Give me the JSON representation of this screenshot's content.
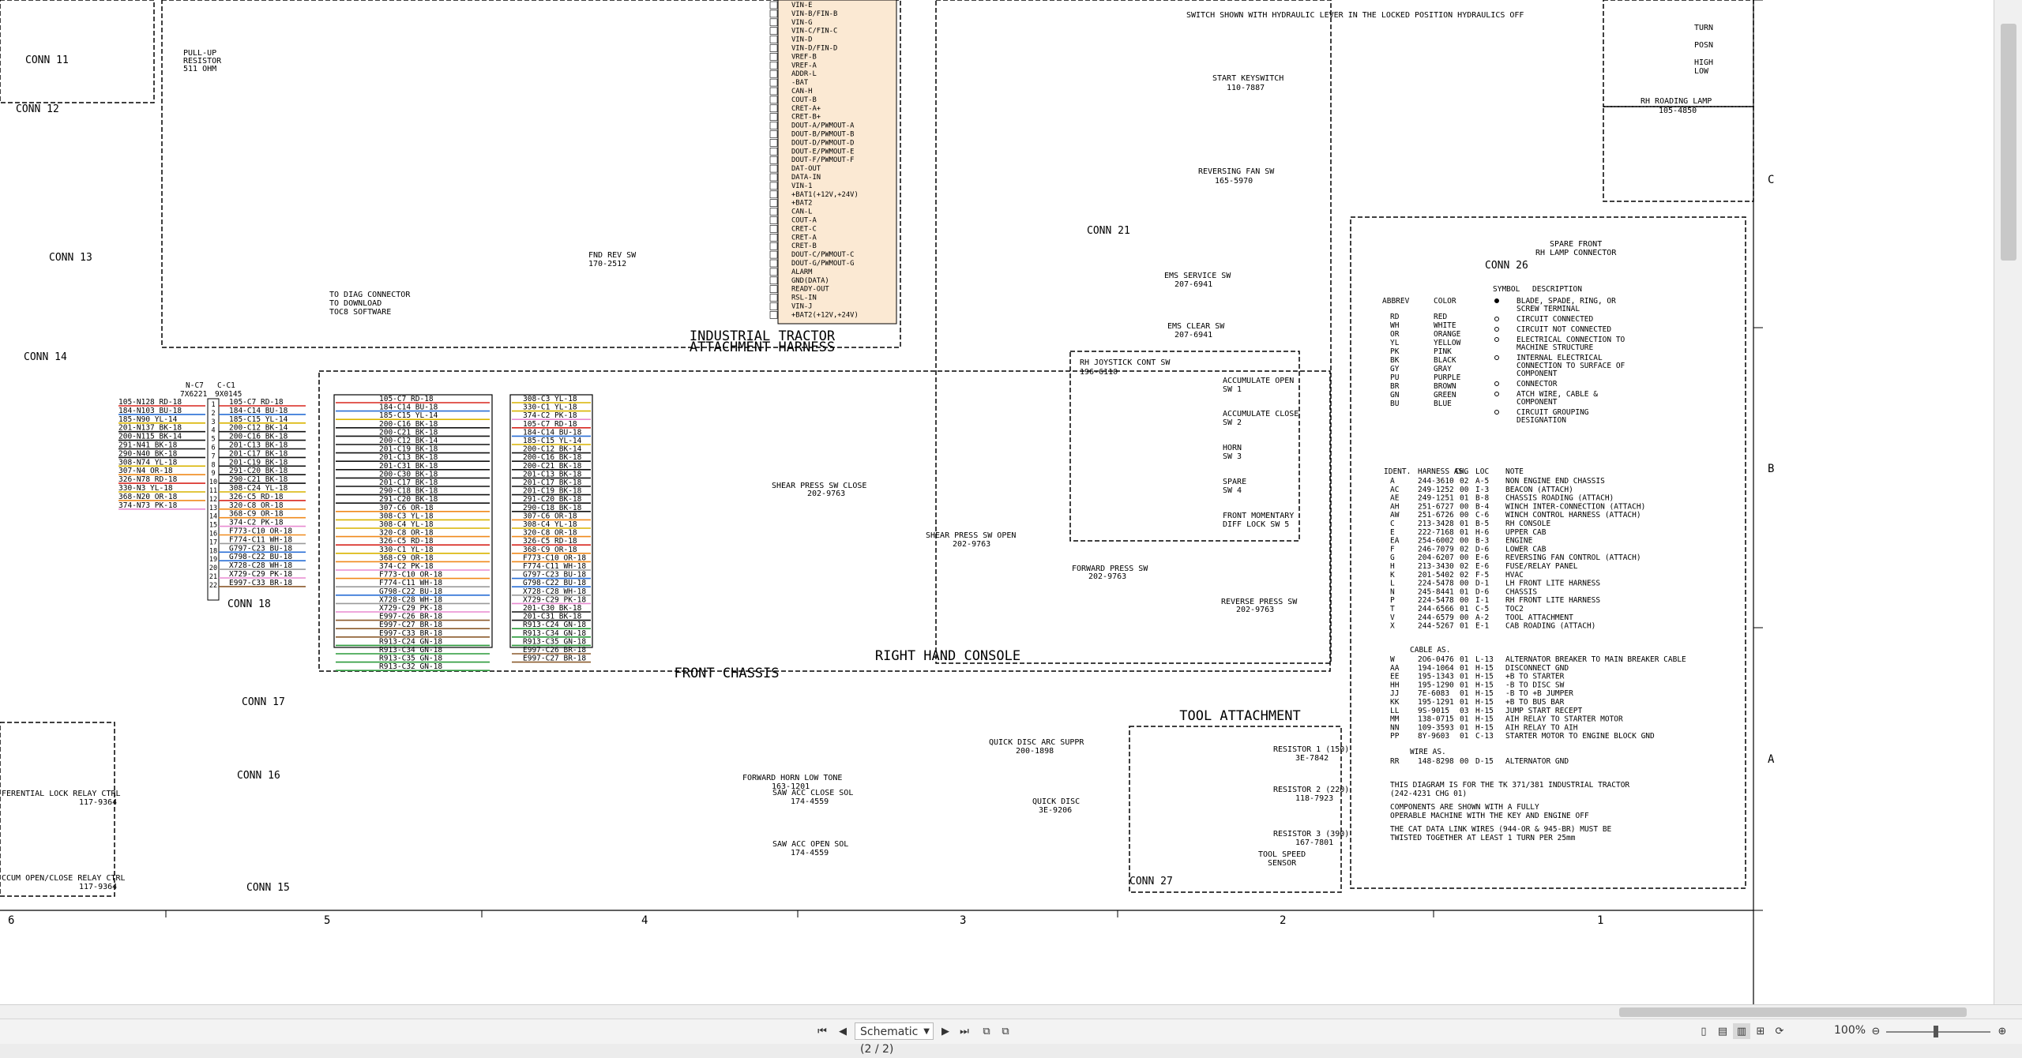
{
  "toolbar": {
    "page_selector": "Schematic (2 / 2)",
    "zoom": "100%"
  },
  "ruler": {
    "bottom": [
      "6",
      "5",
      "4",
      "3",
      "2",
      "1"
    ],
    "right": [
      "C",
      "B",
      "A"
    ]
  },
  "sections": {
    "industrial_tractor": "INDUSTRIAL TRACTOR",
    "attachment_harness": "ATTACHMENT HARNESS",
    "front_chassis": "FRONT CHASSIS",
    "right_hand_console": "RIGHT HAND CONSOLE",
    "tool_attachment": "TOOL ATTACHMENT"
  },
  "connectors": {
    "conn12": "CONN 12",
    "conn11": "CONN 11",
    "conn13": "CONN 13",
    "conn14": "CONN 14",
    "conn18": "CONN 18",
    "conn17": "CONN 17",
    "conn16": "CONN 16",
    "conn15": "CONN 15",
    "conn21": "CONN 21",
    "conn26": "CONN 26",
    "conn27": "CONN 27"
  },
  "components": {
    "keyswitch": "START KEYSWITCH",
    "keyswitch_pn": "110-7887",
    "hyd_switch": "SWITCH SHOWN WITH HYDRAULIC LEVER IN THE LOCKED POSITION HYDRAULICS OFF",
    "reversing_fan": "REVERSING FAN SW",
    "reversing_fan_pn": "165-5970",
    "ems_service": "EMS SERVICE SW",
    "ems_service_pn": "207-6941",
    "ems_clear": "EMS CLEAR SW",
    "ems_clear_pn": "207-6941",
    "joystick": "RH JOYSTICK CONT SW",
    "joystick_pn": "196-6110",
    "accumulate_open": "ACCUMULATE OPEN",
    "accumulate_open_sw": "SW 1",
    "accumulate_close": "ACCUMULATE CLOSE",
    "accumulate_close_sw": "SW 2",
    "horn": "HORN",
    "horn_sw": "SW 3",
    "spare": "SPARE",
    "spare_sw": "SW 4",
    "front_diff": "FRONT MOMENTARY",
    "front_diff_sw": "DIFF LOCK SW 5",
    "shear_close": "SHEAR PRESS SW CLOSE",
    "shear_close_pn": "202-9763",
    "shear_open": "SHEAR PRESS SW OPEN",
    "shear_open_pn": "202-9763",
    "forward_press": "FORWARD PRESS SW",
    "forward_press_pn": "202-9763",
    "reverse_press": "REVERSE PRESS SW",
    "reverse_press_pn": "202-9763",
    "fnd_rev": "FND REV SW",
    "fnd_rev_pn": "170-2512",
    "diag": "TO DIAG CONNECTOR",
    "diag2": "TO DOWNLOAD",
    "diag3": "TOC8 SOFTWARE",
    "pullup": "PULL-UP",
    "pullup2": "RESISTOR",
    "pullup3": "511 OHM",
    "horn_tone": "FORWARD HORN LOW TONE",
    "horn_tone_pn": "163-1201",
    "quick_disc": "QUICK DISC ARC SUPPR",
    "quick_disc_pn": "200-1898",
    "saw_close": "SAW ACC CLOSE SOL",
    "saw_close_pn": "174-4559",
    "saw_open": "SAW ACC OPEN SOL",
    "saw_open_pn": "174-4559",
    "quick_disc2": "QUICK DISC",
    "quick_disc2_pn": "3E-9206",
    "res1": "RESISTOR 1 (150)",
    "res1_pn": "3E-7842",
    "res2": "RESISTOR 2 (220)",
    "res2_pn": "118-7923",
    "res3": "RESISTOR 3 (390)",
    "res3_pn": "167-7801",
    "tool_speed": "TOOL SPEED",
    "tool_speed2": "SENSOR",
    "spare_front": "SPARE FRONT",
    "spare_front2": "RH LAMP CONNECTOR",
    "rh_roading": "RH ROADING LAMP",
    "rh_roading_pn": "105-4850",
    "turn": "TURN",
    "posn": "POSN",
    "high": "HIGH",
    "low": "LOW",
    "diff_relay": "FERENTIAL LOCK RELAY CTRL",
    "diff_relay_pn": "117-9364",
    "vacuum_relay": "CCUM OPEN/CLOSE RELAY CTRL",
    "vacuum_relay_pn": "117-9364"
  },
  "ecm_pins": [
    "VIN-E",
    "VIN-B/FIN-B",
    "VIN-G",
    "VIN-C/FIN-C",
    "VIN-D",
    "VIN-D/FIN-D",
    "VREF-B",
    "VREF-A",
    "ADDR-L",
    "-BAT",
    "CAN-H",
    "COUT-B",
    "CRET-A+",
    "CRET-B+",
    "DOUT-A/PWMOUT-A",
    "DOUT-B/PWMOUT-B",
    "DOUT-D/PWMOUT-D",
    "DOUT-E/PWMOUT-E",
    "DOUT-F/PWMOUT-F",
    "DAT-OUT",
    "DATA-IN",
    "VIN-1",
    "+BAT1(+12V,+24V)",
    "+BAT2",
    "CAN-L",
    "COUT-A",
    "CRET-C",
    "CRET-A",
    "CRET-B",
    "DOUT-C/PWMOUT-C",
    "DOUT-G/PWMOUT-G",
    "ALARM",
    "GND(DATA)",
    "READY-OUT",
    "RSL-IN",
    "VIN-J",
    "+BAT2(+12V,+24V)"
  ],
  "legend": {
    "header": [
      "ABBREV",
      "COLOR"
    ],
    "colors": [
      [
        "RD",
        "RED"
      ],
      [
        "WH",
        "WHITE"
      ],
      [
        "OR",
        "ORANGE"
      ],
      [
        "YL",
        "YELLOW"
      ],
      [
        "PK",
        "PINK"
      ],
      [
        "BK",
        "BLACK"
      ],
      [
        "GY",
        "GRAY"
      ],
      [
        "PU",
        "PURPLE"
      ],
      [
        "BR",
        "BROWN"
      ],
      [
        "GN",
        "GREEN"
      ],
      [
        "BU",
        "BLUE"
      ]
    ],
    "sym_header": [
      "SYMBOL",
      "DESCRIPTION"
    ],
    "symbols": [
      "BLADE, SPADE, RING, OR SCREW TERMINAL",
      "CIRCUIT CONNECTED",
      "CIRCUIT NOT CONNECTED",
      "ELECTRICAL CONNECTION TO MACHINE STRUCTURE",
      "INTERNAL ELECTRICAL CONNECTION TO SURFACE OF COMPONENT",
      "CONNECTOR",
      "ATCH WIRE, CABLE & COMPONENT",
      "CIRCUIT GROUPING DESIGNATION"
    ]
  },
  "harness_table": {
    "header": [
      "IDENT.",
      "HARNESS AS.",
      "CHG",
      "LOC",
      "NOTE"
    ],
    "rows": [
      [
        "A",
        "244-3610",
        "02",
        "A-5",
        "NON ENGINE END CHASSIS"
      ],
      [
        "AC",
        "249-1252",
        "00",
        "I-3",
        "BEACON (ATTACH)"
      ],
      [
        "AE",
        "249-1251",
        "01",
        "B-8",
        "CHASSIS ROADING (ATTACH)"
      ],
      [
        "AH",
        "251-6727",
        "00",
        "B-4",
        "WINCH INTER-CONNECTION (ATTACH)"
      ],
      [
        "AW",
        "251-6726",
        "00",
        "C-6",
        "WINCH CONTROL HARNESS (ATTACH)"
      ],
      [
        "C",
        "213-3428",
        "01",
        "B-5",
        "RH CONSOLE"
      ],
      [
        "E",
        "222-7168",
        "01",
        "H-6",
        "UPPER CAB"
      ],
      [
        "EA",
        "254-6002",
        "00",
        "B-3",
        "ENGINE"
      ],
      [
        "F",
        "246-7079",
        "02",
        "D-6",
        "LOWER CAB"
      ],
      [
        "G",
        "204-6207",
        "00",
        "E-6",
        "REVERSING FAN CONTROL (ATTACH)"
      ],
      [
        "H",
        "213-3430",
        "02",
        "E-6",
        "FUSE/RELAY PANEL"
      ],
      [
        "K",
        "201-5402",
        "02",
        "F-5",
        "HVAC"
      ],
      [
        "L",
        "224-5478",
        "00",
        "D-1",
        "LH FRONT LITE HARNESS"
      ],
      [
        "N",
        "245-8441",
        "01",
        "D-6",
        "CHASSIS"
      ],
      [
        "P",
        "224-5478",
        "00",
        "I-1",
        "RH FRONT LITE HARNESS"
      ],
      [
        "T",
        "244-6566",
        "01",
        "C-5",
        "TOC2"
      ],
      [
        "V",
        "244-6579",
        "00",
        "A-2",
        "TOOL ATTACHMENT"
      ],
      [
        "X",
        "244-5267",
        "01",
        "E-1",
        "CAB ROADING (ATTACH)"
      ]
    ]
  },
  "cable_table": {
    "title": "CABLE AS.",
    "rows": [
      [
        "W",
        "2O6-0476",
        "01",
        "L-13",
        "ALTERNATOR BREAKER TO MAIN BREAKER CABLE"
      ],
      [
        "AA",
        "194-1064",
        "01",
        "H-15",
        "DISCONNECT GND"
      ],
      [
        "EE",
        "195-1343",
        "01",
        "H-15",
        "+B TO STARTER"
      ],
      [
        "HH",
        "195-1290",
        "01",
        "H-15",
        "-B TO DISC SW"
      ],
      [
        "JJ",
        "7E-6083",
        "01",
        "H-15",
        "-B TO +B JUMPER"
      ],
      [
        "KK",
        "195-1291",
        "01",
        "H-15",
        "+B TO BUS BAR"
      ],
      [
        "LL",
        "9S-9015",
        "03",
        "H-15",
        "JUMP START RECEPT"
      ],
      [
        "MM",
        "138-0715",
        "01",
        "H-15",
        "AIH RELAY TO STARTER MOTOR"
      ],
      [
        "NN",
        "109-3593",
        "01",
        "H-15",
        "AIH RELAY TO AIH"
      ],
      [
        "PP",
        "8Y-9603",
        "01",
        "C-13",
        "STARTER MOTOR TO ENGINE BLOCK GND"
      ]
    ],
    "wire_title": "WIRE AS.",
    "wire_row": [
      "RR",
      "148-8298",
      "00",
      "D-15",
      "ALTERNATOR GND"
    ]
  },
  "notes": [
    "THIS DIAGRAM IS FOR THE TK 371/381 INDUSTRIAL TRACTOR",
    "(242-4231 CHG 01)",
    "COMPONENTS ARE SHOWN WITH A FULLY",
    "OPERABLE MACHINE WITH THE KEY AND ENGINE OFF",
    "THE CAT DATA LINK WIRES (944-OR & 945-BR) MUST BE",
    "TWISTED TOGETHER AT LEAST 1 TURN PER 25mm"
  ],
  "wires": {
    "conn18_left": [
      "N-C7",
      "7X6221",
      "C-C1",
      "9X0145"
    ],
    "conn18_c1": [
      "105-C7 RD-18",
      "184-C14 BU-18",
      "185-C15 YL-14",
      "200-C12 BK-14",
      "200-C16 BK-18",
      "201-C13 BK-18",
      "201-C17 BK-18",
      "201-C19 BK-18",
      "291-C20 BK-18",
      "290-C21 BK-18",
      "308-C24 YL-18",
      "326-C5 RD-18",
      "320-C8 OR-18",
      "368-C9 OR-18",
      "374-C2 PK-18",
      "F773-C10 OR-18",
      "F774-C11 WH-18",
      "G797-C23 BU-18",
      "G798-C22 BU-18",
      "X728-C28 WH-18",
      "X729-C29 PK-18",
      "E997-C33 BR-18"
    ],
    "conn18_n": [
      "105-N128 RD-18",
      "184-N103 BU-18",
      "185-N90 YL-14",
      "201-N137 BK-18",
      "200-N115 BK-14",
      "291-N41 BK-18",
      "290-N40 BK-18",
      "308-N74 YL-18",
      "307-N4 OR-18",
      "326-N78 RD-18",
      "330-N3 YL-18",
      "368-N20 OR-18",
      "374-N73 PK-18"
    ],
    "mid_block": [
      "105-C7 RD-18",
      "184-C14 BU-18",
      "185-C15 YL-14",
      "200-C16 BK-18",
      "200-C21 BK-18",
      "200-C12 BK-14",
      "201-C19 BK-18",
      "201-C13 BK-18",
      "201-C31 BK-18",
      "200-C30 BK-18",
      "201-C17 BK-18",
      "290-C18 BK-18",
      "291-C20 BK-18",
      "307-C6 OR-18",
      "308-C3 YL-18",
      "308-C4 YL-18",
      "320-C8 OR-18",
      "326-C5 RD-18",
      "330-C1 YL-18",
      "368-C9 OR-18",
      "374-C2 PK-18",
      "F773-C10 OR-18",
      "F774-C11 WH-18",
      "G798-C22 BU-18",
      "X728-C28 WH-18",
      "X729-C29 PK-18",
      "E997-C26 BR-18",
      "E997-C27 BR-18",
      "E997-C33 BR-18",
      "R913-C24 GN-18",
      "R913-C34 GN-18",
      "R913-C35 GN-18",
      "R913-C32 GN-18"
    ],
    "right_block": [
      "308-C3 YL-18",
      "330-C1 YL-18",
      "374-C2 PK-18",
      "105-C7 RD-18",
      "184-C14 BU-18",
      "185-C15 YL-14",
      "200-C12 BK-14",
      "200-C16 BK-18",
      "200-C21 BK-18",
      "201-C13 BK-18",
      "201-C17 BK-18",
      "201-C19 BK-18",
      "291-C20 BK-18",
      "290-C18 BK-18",
      "307-C6 OR-18",
      "308-C4 YL-18",
      "320-C8 OR-18",
      "326-C5 RD-18",
      "368-C9 OR-18",
      "F773-C10 OR-18",
      "F774-C11 WH-18",
      "G797-C23 BU-18",
      "G798-C22 BU-18",
      "X728-C28 WH-18",
      "X729-C29 PK-18",
      "201-C30 BK-18",
      "201-C31 BK-18",
      "R913-C24 GN-18",
      "R913-C34 GN-18",
      "R913-C35 GN-18",
      "E997-C26 BR-18",
      "E997-C27 BR-18"
    ]
  }
}
